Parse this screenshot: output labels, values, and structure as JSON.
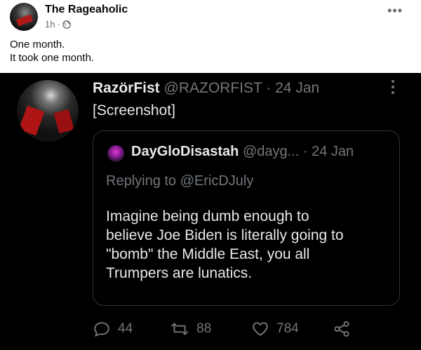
{
  "facebook_post": {
    "author": "The Rageaholic",
    "time": "1h",
    "separator": "·",
    "privacy_icon": "globe-icon",
    "more_icon": "ellipsis-icon",
    "more_label": "•••",
    "text_lines": [
      "One month.",
      "It took one month."
    ]
  },
  "tweet": {
    "display_name": "RazörFist",
    "handle": "@RAZORFIST",
    "date": "· 24 Jan",
    "text": "[Screenshot]",
    "more_icon": "vertical-ellipsis-icon",
    "quote": {
      "display_name": "DayGloDisastah",
      "handle": "@dayg...",
      "date": "· 24 Jan",
      "replying_to": "Replying to @EricDJuly",
      "text_lines": [
        "Imagine being dumb enough to",
        "believe Joe Biden is literally going to",
        "\"bomb\" the Middle East, you all",
        "Trumpers are lunatics."
      ]
    },
    "actions": {
      "replies": "44",
      "retweets": "88",
      "likes": "784"
    }
  },
  "colors": {
    "tweet_background": "#000000",
    "tweet_text": "#e7e9ea",
    "tweet_muted": "#71767b",
    "fb_text": "#050505",
    "fb_muted": "#65676b"
  }
}
